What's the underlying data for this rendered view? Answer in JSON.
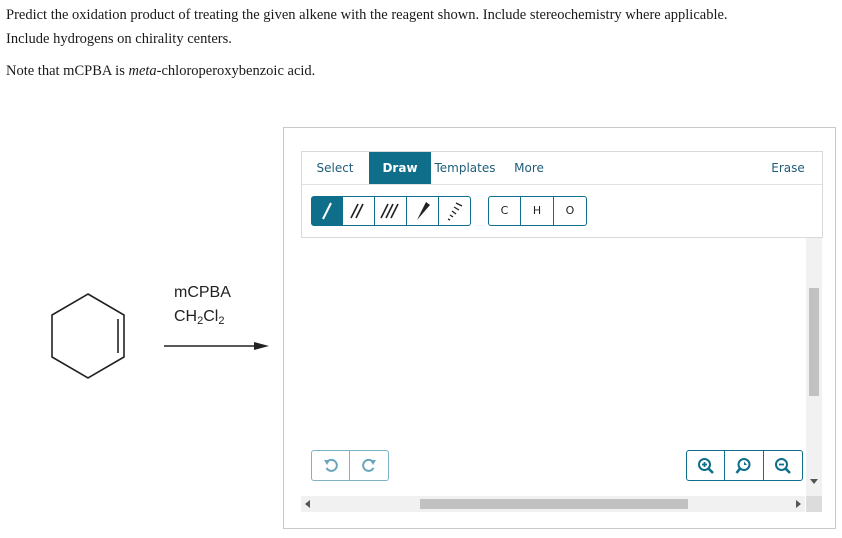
{
  "question": {
    "line1": "Predict the oxidation product of treating the given alkene with the reagent shown. Include stereochemistry where applicable.",
    "line2": "Include hydrogens on chirality centers.",
    "note_prefix": "Note that mCPBA is ",
    "note_italic": "meta",
    "note_suffix": "-chloroperoxybenzoic acid."
  },
  "reaction": {
    "starting_material": "cyclohexene",
    "reagent1": "mCPBA",
    "reagent2_main": "CH",
    "reagent2_sub1": "2",
    "reagent2_mid": "Cl",
    "reagent2_sub2": "2"
  },
  "editor": {
    "tabs": {
      "select": "Select",
      "draw": "Draw",
      "templates": "Templates",
      "more": "More"
    },
    "erase": "Erase",
    "active_tab": "Draw",
    "bond_tools": [
      "single-bond-icon",
      "double-bond-icon",
      "triple-bond-icon",
      "wedge-bond-icon",
      "hash-bond-icon"
    ],
    "atoms": [
      "C",
      "H",
      "O"
    ],
    "undo_icons": [
      "undo-icon",
      "redo-icon"
    ],
    "zoom_icons": [
      "zoom-in-icon",
      "zoom-reset-icon",
      "zoom-out-icon"
    ],
    "colors": {
      "accent": "#0f6e8a",
      "muted_border": "#7fb2c4",
      "scroll_thumb": "#c1c1c1"
    }
  }
}
